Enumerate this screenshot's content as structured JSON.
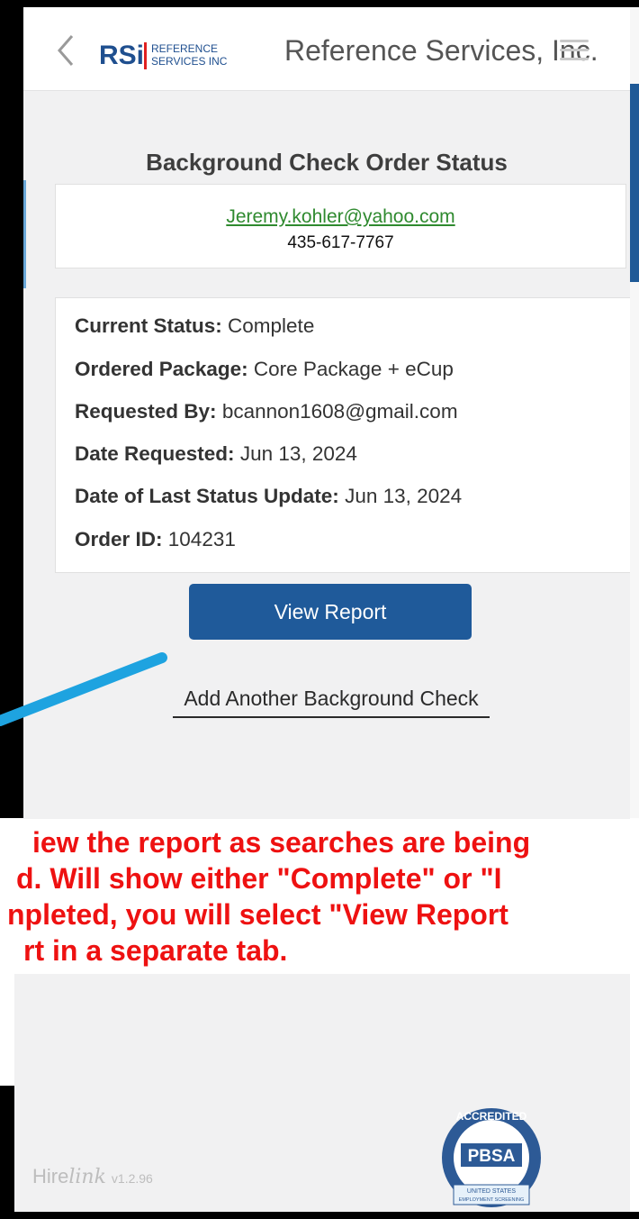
{
  "header": {
    "logo_letters": "RSi",
    "logo_line1": "REFERENCE",
    "logo_line2": "SERVICES INC",
    "brand_title": "Reference Services, Inc."
  },
  "page": {
    "title": "Background Check Order Status"
  },
  "contact": {
    "email": "Jeremy.kohler@yahoo.com",
    "phone": "435-617-7767"
  },
  "order": {
    "rows": [
      {
        "label": "Current Status:",
        "value": "Complete"
      },
      {
        "label": "Ordered Package:",
        "value": "Core Package + eCup"
      },
      {
        "label": "Requested By:",
        "value": "bcannon1608@gmail.com"
      },
      {
        "label": "Date Requested:",
        "value": "Jun 13, 2024"
      },
      {
        "label": "Date of Last Status Update:",
        "value": "Jun 13, 2024"
      },
      {
        "label": "Order ID:",
        "value": "104231"
      }
    ]
  },
  "actions": {
    "view_report": "View Report",
    "add_another": "Add Another Background Check"
  },
  "annotation": {
    "lines": [
      "iew the report as searches are being",
      "d. Will show either \"Complete\" or \"I",
      "npleted, you will select \"View Report",
      "rt in a separate tab."
    ]
  },
  "footer": {
    "brand_hire": "Hire",
    "brand_link": "link",
    "version": "v1.2.96",
    "badge_top": "ACCREDITED",
    "badge_main": "PBSA",
    "badge_bottom1": "UNITED STATES",
    "badge_bottom2": "EMPLOYMENT SCREENING"
  },
  "colors": {
    "primary_button": "#1f5a9a",
    "annotation_red": "#ee1111",
    "arrow_blue": "#1ea3e0",
    "email_green": "#2f8a2f"
  }
}
